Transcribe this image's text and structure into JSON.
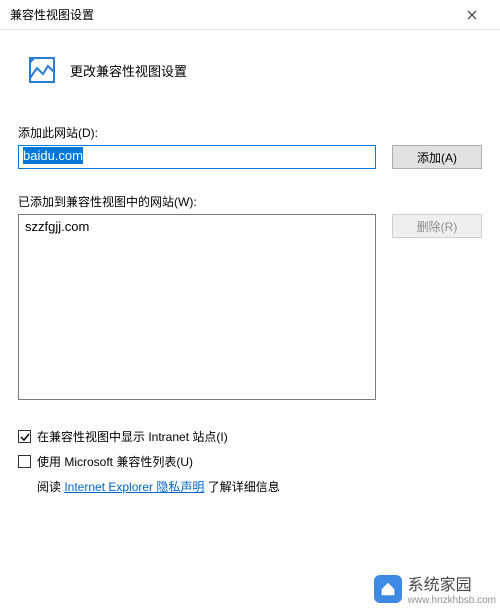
{
  "window": {
    "title": "兼容性视图设置"
  },
  "header": {
    "title": "更改兼容性视图设置"
  },
  "add_section": {
    "label": "添加此网站(D):",
    "input_value": "baidu.com",
    "add_button": "添加(A)"
  },
  "list_section": {
    "label": "已添加到兼容性视图中的网站(W):",
    "items": [
      "szzfgjj.com"
    ],
    "remove_button": "删除(R)"
  },
  "options": {
    "intranet_checked": true,
    "intranet_label": "在兼容性视图中显示 Intranet 站点(I)",
    "mslist_checked": false,
    "mslist_label": "使用 Microsoft 兼容性列表(U)",
    "link_prefix": "阅读 ",
    "link_text": "Internet Explorer 隐私声明",
    "link_suffix": " 了解详细信息"
  },
  "watermark": {
    "text": "系统家园",
    "sub": "www.hnzkhbsb.com"
  }
}
